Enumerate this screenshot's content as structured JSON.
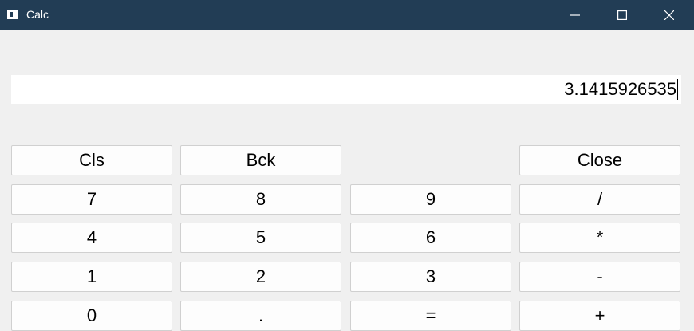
{
  "window": {
    "title": "Calc",
    "controls": [
      "minimize-icon",
      "maximize-icon",
      "close-icon"
    ]
  },
  "display": {
    "value": "3.1415926535"
  },
  "keypad": {
    "rows": [
      [
        "Cls",
        "Bck",
        null,
        "Close"
      ],
      [
        "7",
        "8",
        "9",
        "/"
      ],
      [
        "4",
        "5",
        "6",
        "*"
      ],
      [
        "1",
        "2",
        "3",
        "-"
      ],
      [
        "0",
        ".",
        "=",
        "+"
      ]
    ]
  },
  "colors": {
    "titlebar": "#223d55",
    "background": "#f0f0f0",
    "button": "#fdfdfd"
  }
}
